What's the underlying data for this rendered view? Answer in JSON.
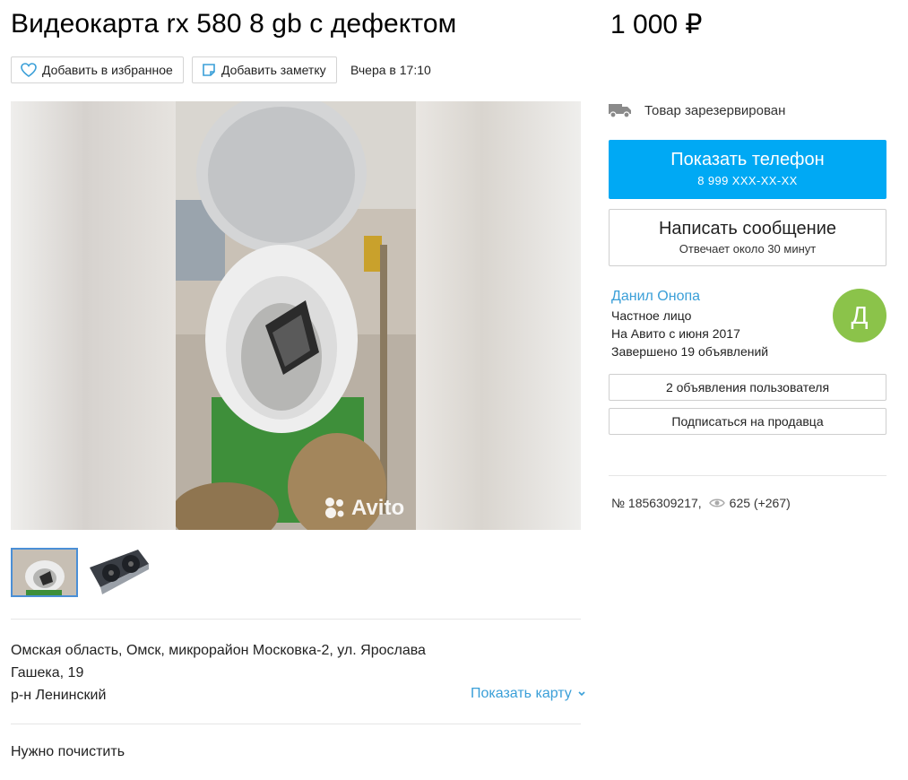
{
  "listing": {
    "title": "Видеокарта rx 580 8 gb с дефектом",
    "price": "1 000 ₽",
    "posted": "Вчера в 17:10",
    "address_line1": "Омская область, Омск, микрорайон Московка-2, ул. Ярослава",
    "address_line2": "Гашека, 19",
    "district": "р-н Ленинский",
    "description": "Нужно почистить",
    "number": "№ 1856309217,",
    "views": "625 (+267)"
  },
  "actions": {
    "favorite_label": "Добавить в избранное",
    "note_label": "Добавить заметку",
    "show_map_label": "Показать карту"
  },
  "gallery": {
    "watermark": "Avito",
    "thumbnail_count": 2,
    "selected_index": 0
  },
  "sidebar": {
    "status": "Товар зарезервирован",
    "phone_button_title": "Показать телефон",
    "phone_masked": "8 999 XXX-XX-XX",
    "message_button_title": "Написать сообщение",
    "message_button_subtitle": "Отвечает около 30 минут",
    "seller_name": "Данил Онопа",
    "seller_type": "Частное лицо",
    "seller_since": "На Авито с июня 2017",
    "seller_completed": "Завершено 19 объявлений",
    "avatar_letter": "Д",
    "user_ads_label": "2 объявления пользователя",
    "subscribe_label": "Подписаться на продавца"
  },
  "colors": {
    "accent": "#00a9f4",
    "link": "#3a9fd8",
    "avatar": "#8bc34a",
    "thumb_selected_border": "#4a8fd6"
  },
  "icons": [
    "heart-icon",
    "note-icon",
    "truck-icon",
    "eye-icon",
    "chevron-down-icon",
    "avito-logo-icon"
  ]
}
